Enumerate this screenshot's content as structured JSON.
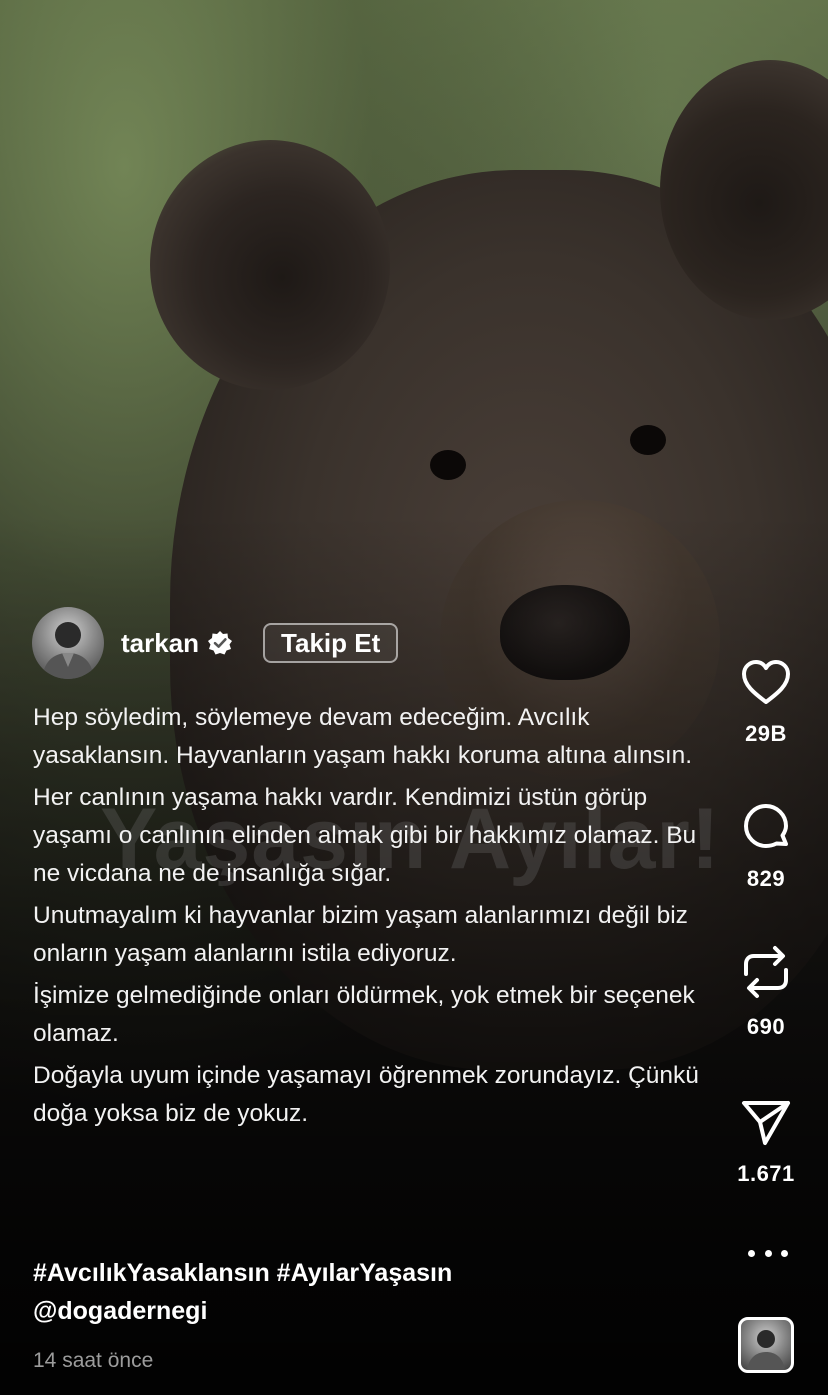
{
  "post": {
    "username": "tarkan",
    "follow_label": "Takip Et",
    "watermark": "Yaşasın Ayılar!",
    "caption": [
      "Hep söyledim, söylemeye devam edeceğim. Avcılık yasaklansın. Hayvanların yaşam hakkı koruma altına alınsın.",
      "Her canlının yaşama hakkı vardır. Kendimizi üstün görüp yaşamı o canlının elinden almak gibi bir hakkımız olamaz. Bu ne vicdana ne de insanlığa sığar.",
      "Unutmayalım ki hayvanlar bizim yaşam alanlarımızı değil biz onların yaşam alanlarını istila ediyoruz.",
      "İşimize gelmediğinde onları öldürmek, yok etmek bir seçenek olamaz.",
      "Doğayla uyum içinde yaşamayı öğrenmek zorundayız. Çünkü doğa yoksa biz de yokuz."
    ],
    "hashtags": "#AvcılıkYasaklansın #AyılarYaşasın",
    "mention": "@dogadernegi",
    "time_ago": "14 saat önce"
  },
  "actions": {
    "like_count": "29B",
    "comment_count": "829",
    "repost_count": "690",
    "share_count": "1.671"
  },
  "icons": [
    "verified-badge-icon",
    "heart-icon",
    "comment-icon",
    "repost-icon",
    "share-icon",
    "more-icon"
  ]
}
